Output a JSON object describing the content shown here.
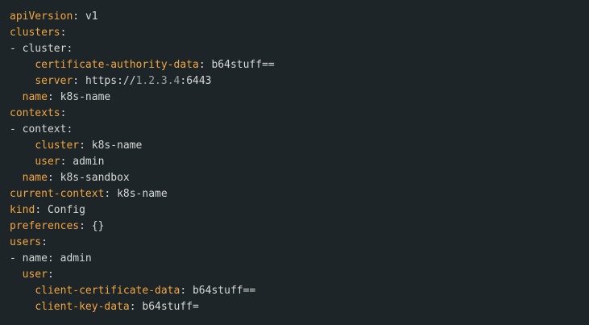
{
  "code": {
    "lines": [
      {
        "indent": "",
        "prefix": "",
        "key": "apiVersion",
        "sep": ": ",
        "value": "v1"
      },
      {
        "indent": "",
        "prefix": "",
        "key": "clusters",
        "sep": ":",
        "value": ""
      },
      {
        "indent": "",
        "prefix": "- ",
        "key": "",
        "plain": "cluster:",
        "value": ""
      },
      {
        "indent": "    ",
        "prefix": "",
        "key": "certificate-authority-data",
        "sep": ": ",
        "value": "b64stuff=="
      },
      {
        "indent": "    ",
        "prefix": "",
        "key": "server",
        "sep": ": ",
        "value_parts": [
          "https://",
          "1.2.3.4",
          ":",
          "6443"
        ]
      },
      {
        "indent": "  ",
        "prefix": "",
        "key": "name",
        "sep": ": ",
        "value": "k8s-name"
      },
      {
        "indent": "",
        "prefix": "",
        "key": "contexts",
        "sep": ":",
        "value": ""
      },
      {
        "indent": "",
        "prefix": "- ",
        "key": "",
        "plain": "context:",
        "value": ""
      },
      {
        "indent": "    ",
        "prefix": "",
        "key": "cluster",
        "sep": ": ",
        "value": "k8s-name"
      },
      {
        "indent": "    ",
        "prefix": "",
        "key": "user",
        "sep": ": ",
        "value": "admin"
      },
      {
        "indent": "  ",
        "prefix": "",
        "key": "name",
        "sep": ": ",
        "value": "k8s-sandbox"
      },
      {
        "indent": "",
        "prefix": "",
        "key": "current-context",
        "sep": ": ",
        "value": "k8s-name"
      },
      {
        "indent": "",
        "prefix": "",
        "key": "kind",
        "sep": ": ",
        "value": "Config"
      },
      {
        "indent": "",
        "prefix": "",
        "key": "preferences",
        "sep": ": ",
        "value": "{}"
      },
      {
        "indent": "",
        "prefix": "",
        "key": "users",
        "sep": ":",
        "value": ""
      },
      {
        "indent": "",
        "prefix": "- ",
        "key": "",
        "plain": "name: admin",
        "value": ""
      },
      {
        "indent": "  ",
        "prefix": "",
        "key": "user",
        "sep": ":",
        "value": ""
      },
      {
        "indent": "    ",
        "prefix": "",
        "key": "client-certificate-data",
        "sep": ": ",
        "value": "b64stuff=="
      },
      {
        "indent": "    ",
        "prefix": "",
        "key": "client-key-data",
        "sep": ": ",
        "value": "b64stuff="
      }
    ]
  },
  "colors": {
    "background": "#1e2528",
    "key": "#f0a643",
    "text": "#d6d8d8",
    "dim": "#9aa2a3"
  }
}
